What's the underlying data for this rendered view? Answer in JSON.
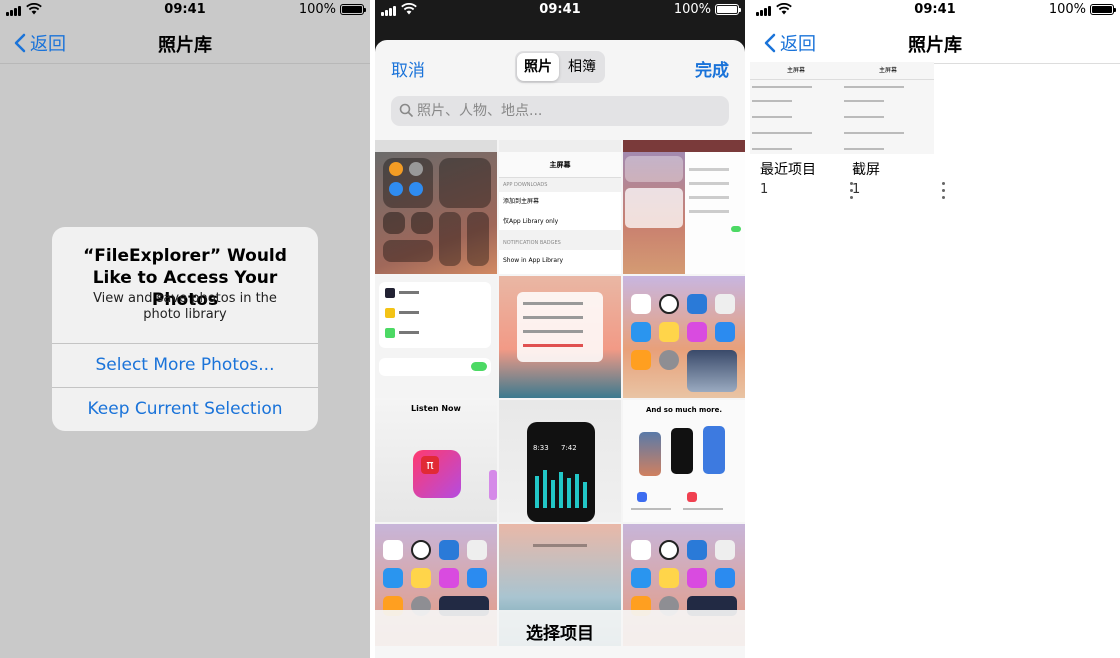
{
  "status_bar": {
    "time": "09:41",
    "battery": "100%"
  },
  "panel1": {
    "nav": {
      "back": "返回",
      "title": "照片库"
    },
    "alert": {
      "title": "“FileExplorer” Would Like to Access Your Photos",
      "message": "View and save photos in the photo library",
      "button_primary": "Select More Photos...",
      "button_secondary": "Keep Current Selection"
    }
  },
  "panel2": {
    "cancel": "取消",
    "done": "完成",
    "tabs": [
      "照片",
      "相簿"
    ],
    "active_tab": "照片",
    "search_placeholder": "照片、人物、地点...",
    "bottom_label": "选择项目",
    "tile_texts": {
      "home_screen": "主屏幕",
      "app_downloads": "APP DOWNLOADS",
      "add_home": "添加到主屏幕",
      "library_only": "仅App Library only",
      "notif_badges": "NOTIFICATION BADGES",
      "show_app_library": "Show in App Library",
      "listen_now": "Listen Now",
      "so_much_more": "And so much more.",
      "time_1": "8:33",
      "time_2": "7:42"
    }
  },
  "panel3": {
    "nav": {
      "back": "返回",
      "title": "照片库"
    },
    "albums": [
      {
        "name": "最近项目",
        "count": "1"
      },
      {
        "name": "截屏",
        "count": "1"
      }
    ]
  },
  "colors": {
    "accent": "#1a73d9"
  }
}
